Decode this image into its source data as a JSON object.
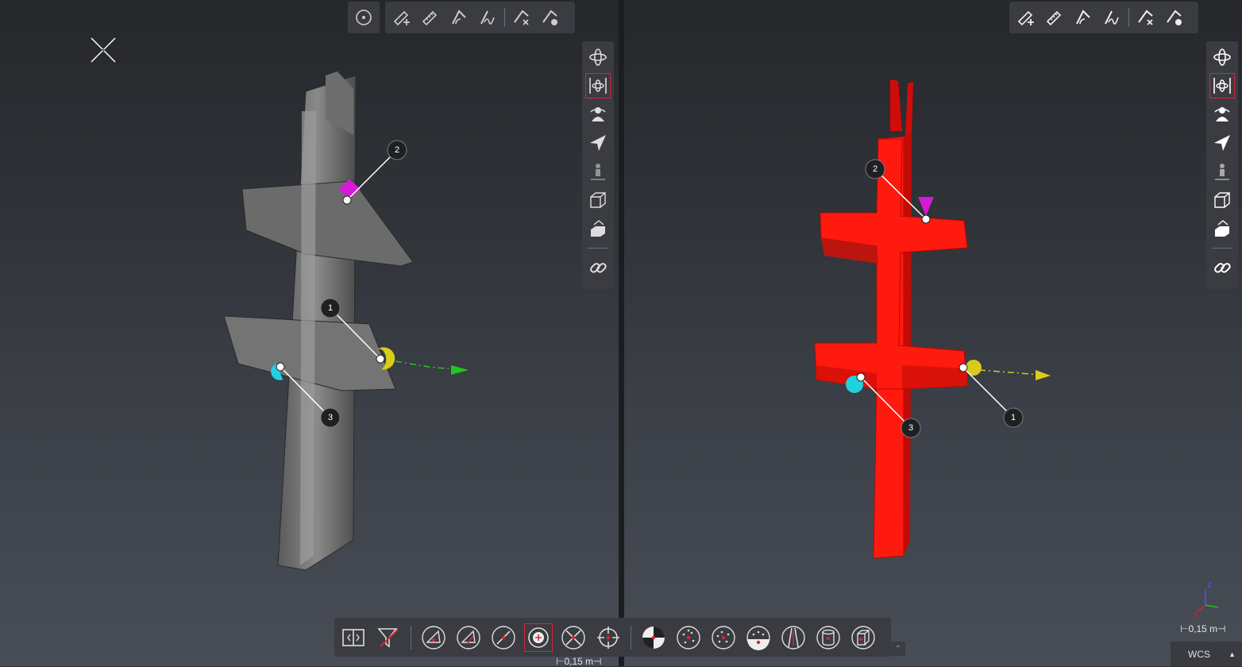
{
  "markers": {
    "m1": "1",
    "m2": "2",
    "m3": "3"
  },
  "scale": {
    "left": "⊢0,15 m⊣",
    "right": "⊢0,15 m⊣"
  },
  "coord_system": {
    "label": "WCS",
    "arrow": "▲"
  },
  "axes": {
    "z": "Z",
    "x": "X",
    "y": "Y"
  },
  "collapse_glyph": "⌃",
  "icons": {
    "top_toolbar_left": [
      "center-point-icon",
      "add-measurement-icon",
      "measure-distance-icon",
      "measure-angle-icon",
      "measure-curve-icon",
      "remove-measurement-icon",
      "hide-measurement-icon"
    ],
    "top_toolbar_right": [
      "add-measurement-icon",
      "measure-distance-icon",
      "measure-angle-icon",
      "measure-curve-icon",
      "remove-measurement-icon",
      "hide-measurement-icon"
    ],
    "side_toolbar": [
      "orbit-icon",
      "pan-orbit-icon",
      "walk-person-icon",
      "fly-icon",
      "stand-person-icon",
      "view-cube-icon",
      "section-box-icon",
      "link-viewports-icon"
    ],
    "bottom_toolbar": [
      "split-view-icon",
      "filter-icon",
      "plane-point-icon",
      "plane-line-icon",
      "line-point-icon",
      "circle-center-icon",
      "line-intersection-icon",
      "crosshair-point-icon",
      "checker-target-icon",
      "sphere-points-icon",
      "point-cloud-select-icon",
      "surface-points-icon",
      "cylinder-lines-icon",
      "cylinder-icon",
      "box-icon"
    ]
  },
  "colors": {
    "accent": "#d2283a",
    "scan_part": "#ff1a10",
    "marker_magenta": "#d41ad4",
    "marker_yellow": "#d8cc1a",
    "marker_cyan": "#1ed2e0"
  }
}
